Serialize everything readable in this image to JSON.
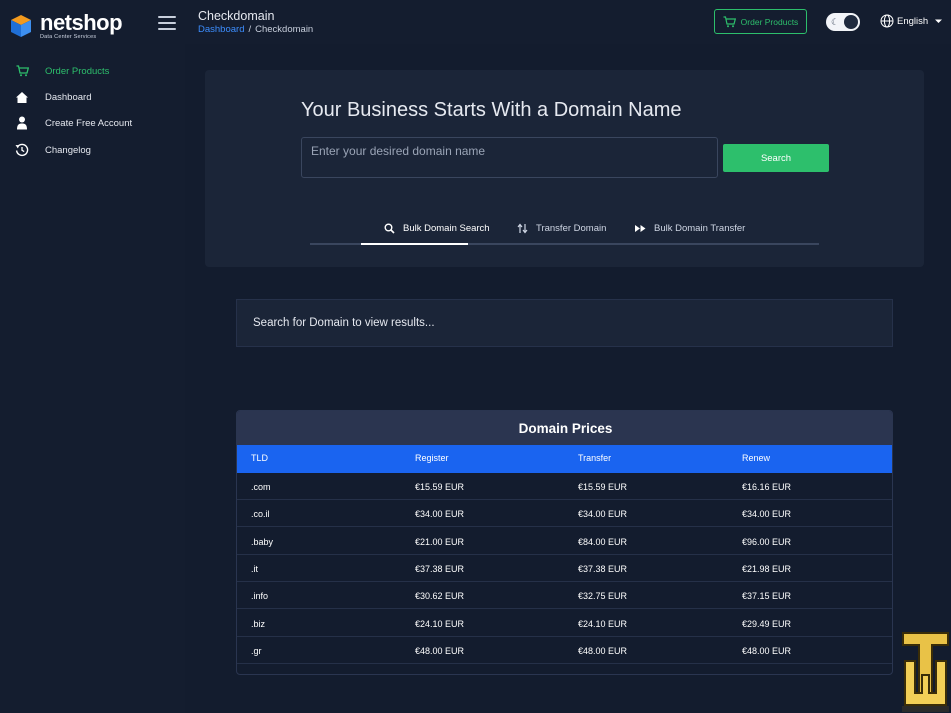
{
  "header": {
    "logo_name": "netshop",
    "logo_tagline": "Data Center Services",
    "page_title": "Checkdomain",
    "breadcrumb": {
      "home": "Dashboard",
      "separator": "/",
      "current": "Checkdomain"
    },
    "order_button": "Order Products",
    "theme_toggle_state": "dark",
    "language": "English"
  },
  "sidebar": {
    "items": [
      {
        "label": "Order Products",
        "icon": "cart-icon",
        "active": true
      },
      {
        "label": "Dashboard",
        "icon": "home-icon",
        "active": false
      },
      {
        "label": "Create Free Account",
        "icon": "user-icon",
        "active": false
      },
      {
        "label": "Changelog",
        "icon": "history-icon",
        "active": false
      }
    ]
  },
  "search": {
    "title": "Your Business Starts With a Domain Name",
    "placeholder": "Enter your desired domain name",
    "button": "Search",
    "tabs": [
      {
        "label": "Bulk Domain Search",
        "icon": "search-icon",
        "active": true
      },
      {
        "label": "Transfer Domain",
        "icon": "swap-icon",
        "active": false
      },
      {
        "label": "Bulk Domain Transfer",
        "icon": "fast-forward-icon",
        "active": false
      }
    ]
  },
  "results": {
    "message": "Search for Domain to view results..."
  },
  "prices": {
    "title": "Domain Prices",
    "columns": [
      "TLD",
      "Register",
      "Transfer",
      "Renew"
    ],
    "rows": [
      [
        ".com",
        "€15.59 EUR",
        "€15.59 EUR",
        "€16.16 EUR"
      ],
      [
        ".co.il",
        "€34.00 EUR",
        "€34.00 EUR",
        "€34.00 EUR"
      ],
      [
        ".baby",
        "€21.00 EUR",
        "€84.00 EUR",
        "€96.00 EUR"
      ],
      [
        ".it",
        "€37.38 EUR",
        "€37.38 EUR",
        "€21.98 EUR"
      ],
      [
        ".info",
        "€30.62 EUR",
        "€32.75 EUR",
        "€37.15 EUR"
      ],
      [
        ".biz",
        "€24.10 EUR",
        "€24.10 EUR",
        "€29.49 EUR"
      ],
      [
        ".gr",
        "€48.00 EUR",
        "€48.00 EUR",
        "€48.00 EUR"
      ]
    ]
  },
  "colors": {
    "accent_green": "#2dbf6c",
    "link_blue": "#3c8dfd",
    "table_header_blue": "#1a64f0",
    "background": "#131c2e"
  }
}
